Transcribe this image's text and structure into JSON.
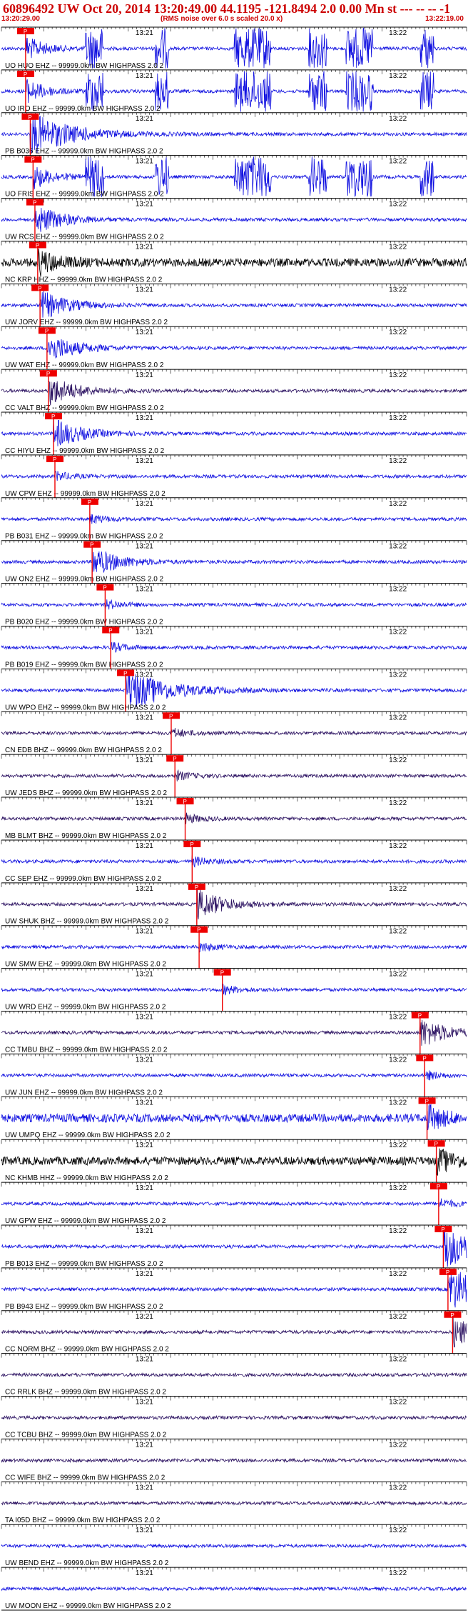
{
  "header": {
    "title": "60896492 UW Oct 20, 2014 13:20:49.00   44.1195 -121.8494  2.0 0.00 Mn st --- -- --   -1",
    "start_time": "13:20:29.00",
    "rms_note": "(RMS noise over 6.0 s scaled 20.0 x)",
    "end_time": "13:22:19.00"
  },
  "chart_data": {
    "type": "seismogram",
    "x_start": "13:20:29.00",
    "x_end": "13:22:19.00",
    "time_ticks": [
      "13:21",
      "13:22"
    ],
    "pick_label": "P",
    "colors": {
      "blue": "#1010e0",
      "dark": "#2a1060",
      "black": "#000000",
      "pick": "#ee0000"
    },
    "traces": [
      {
        "label": "UO HUO EHZ -- 99999.0km BW  HIGHPASS  2.0  2",
        "color": "blue",
        "pick": 0.052,
        "energy": "bursts"
      },
      {
        "label": "UO IRO EHZ -- 99999.0km BW  HIGHPASS  2.0  2",
        "color": "blue",
        "pick": 0.052,
        "energy": "bursts"
      },
      {
        "label": "PB B036 EHZ -- 99999.0km BW  HIGHPASS  2.0  2",
        "color": "blue",
        "pick": 0.062,
        "energy": "strong"
      },
      {
        "label": "UO FRIS EHZ -- 99999.0km BW  HIGHPASS  2.0  2",
        "color": "blue",
        "pick": 0.068,
        "energy": "bursts"
      },
      {
        "label": "UW RCS EHZ -- 99999.0km BW  HIGHPASS  2.0  2",
        "color": "blue",
        "pick": 0.072,
        "energy": "event"
      },
      {
        "label": "NC KRP HHZ -- 99999.0km BW  HIGHPASS  2.0  2",
        "color": "black",
        "pick": 0.078,
        "energy": "noisy"
      },
      {
        "label": "UW JORV EHZ -- 99999.0km BW  HIGHPASS  2.0  2",
        "color": "blue",
        "pick": 0.083,
        "energy": "event"
      },
      {
        "label": "UW WAT EHZ -- 99999.0km BW  HIGHPASS  2.0  2",
        "color": "blue",
        "pick": 0.098,
        "energy": "event"
      },
      {
        "label": "CC VALT BHZ -- 99999.0km BW  HIGHPASS  2.0  2",
        "color": "dark",
        "pick": 0.101,
        "energy": "event"
      },
      {
        "label": "CC HIYU EHZ -- 99999.0km BW  HIGHPASS  2.0  2",
        "color": "blue",
        "pick": 0.112,
        "energy": "event"
      },
      {
        "label": "UW CPW EHZ -- 99999.0km BW  HIGHPASS  2.0  2",
        "color": "blue",
        "pick": 0.115,
        "energy": "quiet"
      },
      {
        "label": "PB B031 EHZ -- 99999.0km BW  HIGHPASS  2.0  2",
        "color": "blue",
        "pick": 0.19,
        "energy": "quiet"
      },
      {
        "label": "UW ON2 EHZ -- 99999.0km BW  HIGHPASS  2.0  2",
        "color": "blue",
        "pick": 0.195,
        "energy": "event"
      },
      {
        "label": "PB B020 EHZ -- 99999.0km BW  HIGHPASS  2.0  2",
        "color": "blue",
        "pick": 0.223,
        "energy": "quiet"
      },
      {
        "label": "PB B019 EHZ -- 99999.0km BW  HIGHPASS  2.0  2",
        "color": "blue",
        "pick": 0.235,
        "energy": "quiet"
      },
      {
        "label": "UW WPO EHZ -- 99999.0km BW  HIGHPASS  2.0  2",
        "color": "blue",
        "pick": 0.267,
        "energy": "strong"
      },
      {
        "label": "CN EDB BHZ -- 99999.0km BW  HIGHPASS  2.0  2",
        "color": "dark",
        "pick": 0.365,
        "energy": "quiet"
      },
      {
        "label": "UW JEDS BHZ -- 99999.0km BW  HIGHPASS  2.0  2",
        "color": "dark",
        "pick": 0.373,
        "energy": "quiet"
      },
      {
        "label": "MB BLMT BHZ -- 99999.0km BW  HIGHPASS  2.0  2",
        "color": "dark",
        "pick": 0.395,
        "energy": "quiet"
      },
      {
        "label": "CC SEP EHZ -- 99999.0km BW  HIGHPASS  2.0  2",
        "color": "blue",
        "pick": 0.41,
        "energy": "quiet"
      },
      {
        "label": "UW SHUK BHZ -- 99999.0km BW  HIGHPASS  2.0  2",
        "color": "dark",
        "pick": 0.42,
        "energy": "event"
      },
      {
        "label": "UW SMW EHZ -- 99999.0km BW  HIGHPASS  2.0  2",
        "color": "blue",
        "pick": 0.425,
        "energy": "quiet"
      },
      {
        "label": "UW WRD EHZ -- 99999.0km BW  HIGHPASS  2.0  2",
        "color": "blue",
        "pick": 0.475,
        "energy": "quiet"
      },
      {
        "label": "CC TMBU BHZ -- 99999.0km BW  HIGHPASS  2.0  2",
        "color": "dark",
        "pick": 0.9,
        "energy": "event"
      },
      {
        "label": "UW JUN EHZ -- 99999.0km BW  HIGHPASS  2.0  2",
        "color": "blue",
        "pick": 0.91,
        "energy": "quiet"
      },
      {
        "label": "UW UMPQ EHZ -- 99999.0km BW  HIGHPASS  2.0  2",
        "color": "blue",
        "pick": 0.915,
        "energy": "noisy"
      },
      {
        "label": "NC KHMB HHZ -- 99999.0km BW  HIGHPASS  2.0  2",
        "color": "black",
        "pick": 0.935,
        "energy": "noisy"
      },
      {
        "label": "UW GPW EHZ -- 99999.0km BW  HIGHPASS  2.0  2",
        "color": "blue",
        "pick": 0.94,
        "energy": "quiet"
      },
      {
        "label": "PB B013 EHZ -- 99999.0km BW  HIGHPASS  2.0  2",
        "color": "blue",
        "pick": 0.95,
        "energy": "strong"
      },
      {
        "label": "PB B943 EHZ -- 99999.0km BW  HIGHPASS  2.0  2",
        "color": "blue",
        "pick": 0.96,
        "energy": "strong"
      },
      {
        "label": "CC NORM BHZ -- 99999.0km BW  HIGHPASS  2.0  2",
        "color": "dark",
        "pick": 0.97,
        "energy": "event"
      },
      {
        "label": "CC RRLK BHZ -- 99999.0km BW  HIGHPASS  2.0  2",
        "color": "dark",
        "pick": null,
        "energy": "quiet"
      },
      {
        "label": "CC TCBU BHZ -- 99999.0km BW  HIGHPASS  2.0  2",
        "color": "dark",
        "pick": null,
        "energy": "quiet"
      },
      {
        "label": "CC WIFE BHZ -- 99999.0km BW  HIGHPASS  2.0  2",
        "color": "dark",
        "pick": null,
        "energy": "quiet"
      },
      {
        "label": "TA I05D BHZ -- 99999.0km BW  HIGHPASS  2.0  2",
        "color": "dark",
        "pick": null,
        "energy": "quiet"
      },
      {
        "label": "UW BEND EHZ -- 99999.0km BW  HIGHPASS  2.0  2",
        "color": "blue",
        "pick": null,
        "energy": "quiet"
      },
      {
        "label": "UW MOON EHZ -- 99999.0km BW  HIGHPASS  2.0  2",
        "color": "blue",
        "pick": null,
        "energy": "quiet"
      }
    ]
  }
}
